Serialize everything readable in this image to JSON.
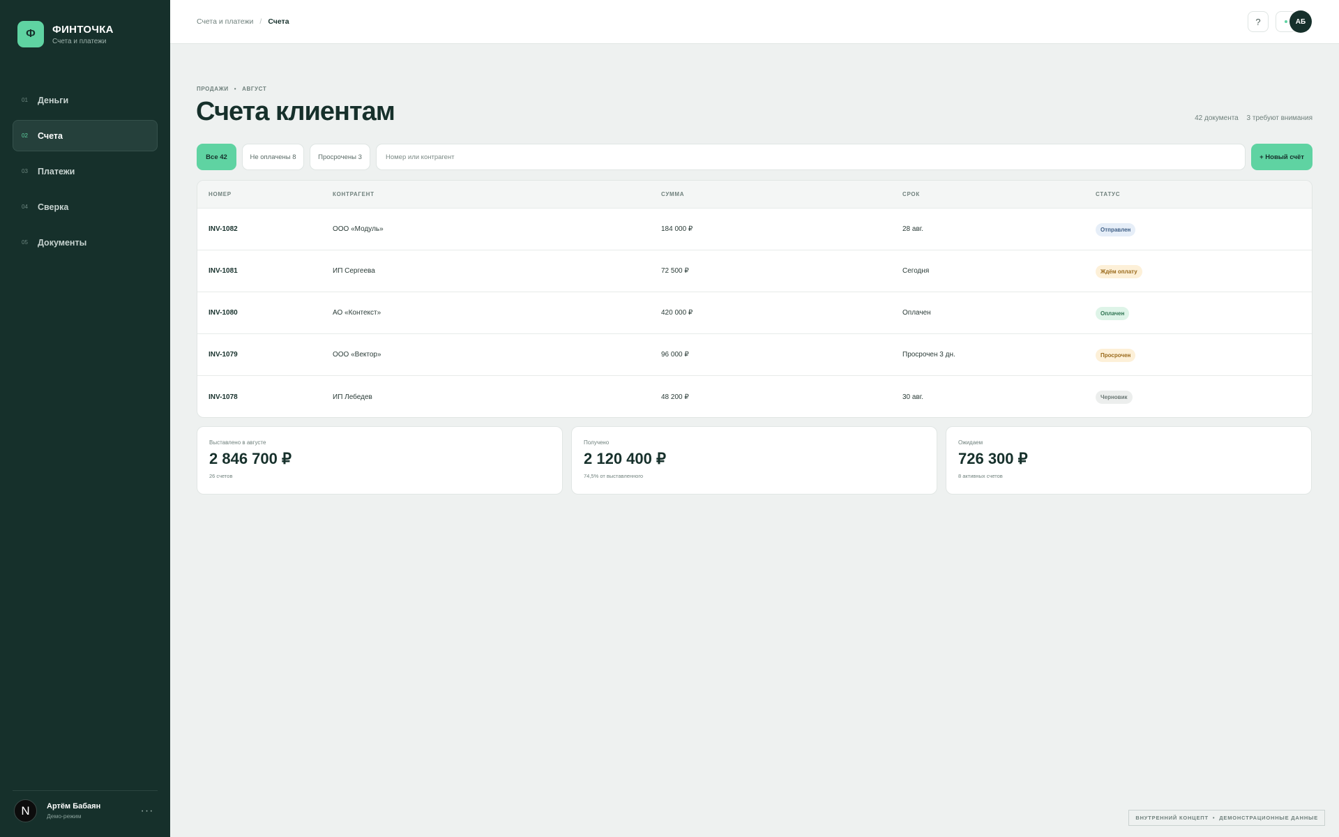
{
  "brand": {
    "logo": "Ф",
    "name": "ФИНТОЧКА",
    "subtitle": "Счета и платежи"
  },
  "nav": [
    {
      "num": "01",
      "label": "Деньги",
      "active": false
    },
    {
      "num": "02",
      "label": "Счета",
      "active": true
    },
    {
      "num": "03",
      "label": "Платежи",
      "active": false
    },
    {
      "num": "04",
      "label": "Сверка",
      "active": false
    },
    {
      "num": "05",
      "label": "Документы",
      "active": false
    }
  ],
  "user": {
    "avatar": "N",
    "name": "Артём Бабаян",
    "mode": "Демо-режим",
    "more": "···"
  },
  "header": {
    "breadcrumb_parent": "Счета и платежи",
    "breadcrumb_sep": "/",
    "breadcrumb_current": "Счета",
    "help": "?",
    "avatar": "АБ"
  },
  "page": {
    "eyebrow_section": "ПРОДАЖИ",
    "eyebrow_bullet": "•",
    "eyebrow_period": "АВГУСТ",
    "title": "Счета клиентам",
    "meta_docs": "42 документа",
    "meta_attention": "3 требуют внимания"
  },
  "filters": {
    "all": "Все 42",
    "unpaid": "Не оплачены 8",
    "overdue": "Просрочены 3",
    "search_placeholder": "Номер или контрагент",
    "new_button": "+ Новый счёт"
  },
  "table": {
    "headers": [
      "НОМЕР",
      "КОНТРАГЕНТ",
      "СУММА",
      "СРОК",
      "СТАТУС"
    ],
    "rows": [
      {
        "number": "INV-1082",
        "counterparty": "ООО «Модуль»",
        "amount": "184 000 ₽",
        "due": "28 авг.",
        "status": "Отправлен"
      },
      {
        "number": "INV-1081",
        "counterparty": "ИП Сергеева",
        "amount": "72 500 ₽",
        "due": "Сегодня",
        "status": "Ждём оплату"
      },
      {
        "number": "INV-1080",
        "counterparty": "АО «Контекст»",
        "amount": "420 000 ₽",
        "due": "Оплачен",
        "status": "Оплачен"
      },
      {
        "number": "INV-1079",
        "counterparty": "ООО «Вектор»",
        "amount": "96 000 ₽",
        "due": "Просрочен 3 дн.",
        "status": "Просрочен"
      },
      {
        "number": "INV-1078",
        "counterparty": "ИП Лебедев",
        "amount": "48 200 ₽",
        "due": "30 авг.",
        "status": "Черновик"
      }
    ],
    "status_colors": {
      "Отправлен": {
        "bg": "#e6eef8",
        "fg": "#3f5f86"
      },
      "Ждём оплату": {
        "bg": "#fdf0d8",
        "fg": "#9a6a1c"
      },
      "Оплачен": {
        "bg": "#def4e8",
        "fg": "#2d7350"
      },
      "Просрочен": {
        "bg": "#fdf0d8",
        "fg": "#9a6a1c"
      },
      "Черновик": {
        "bg": "#eceeed",
        "fg": "#6b7875"
      }
    }
  },
  "stats": [
    {
      "label": "Выставлено в августе",
      "value": "2 846 700 ₽",
      "note": "26 счетов"
    },
    {
      "label": "Получено",
      "value": "2 120 400 ₽",
      "note": "74,5% от выставленного"
    },
    {
      "label": "Ожидаем",
      "value": "726 300 ₽",
      "note": "8 активных счетов"
    }
  ],
  "footer": {
    "left": "ВНУТРЕННИЙ КОНЦЕПТ",
    "sep": "•",
    "right": "ДЕМОНСТРАЦИОННЫЕ ДАННЫЕ"
  },
  "colors": {
    "sidebar": "#16302b",
    "accent": "#5fd3a2",
    "background": "#eef1f0"
  },
  "icons": {
    "help": "question-icon",
    "notifications": "dot-icon",
    "more": "more-icon"
  }
}
